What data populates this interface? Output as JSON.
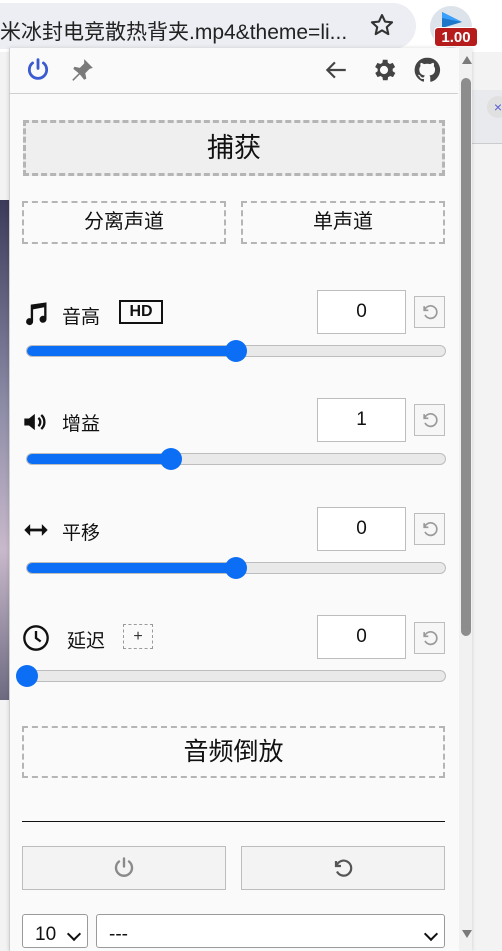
{
  "browser": {
    "url_text": "米冰封电竞散热背夹.mp4&theme=li...",
    "badge": "1.00",
    "side_close": "×"
  },
  "popup": {
    "buttons": {
      "capture": "捕获",
      "split_channels": "分离声道",
      "mono": "单声道",
      "reverse": "音频倒放"
    },
    "controls": [
      {
        "label": "音高",
        "value": "0",
        "fraction": 0.5,
        "icon": "music-note-icon",
        "tag": "HD"
      },
      {
        "label": "增益",
        "value": "1",
        "fraction": 0.345,
        "icon": "volume-icon"
      },
      {
        "label": "平移",
        "value": "0",
        "fraction": 0.5,
        "icon": "left-right-arrow-icon"
      },
      {
        "label": "延迟",
        "value": "0",
        "fraction": 0.0,
        "icon": "clock-icon",
        "tag": "+"
      }
    ],
    "footer": {
      "select_small": "10",
      "select_large": "---"
    },
    "colors": {
      "accent": "#0b6ef5",
      "power_icon": "#3b5bd0",
      "badge": "#b71c1c"
    }
  }
}
